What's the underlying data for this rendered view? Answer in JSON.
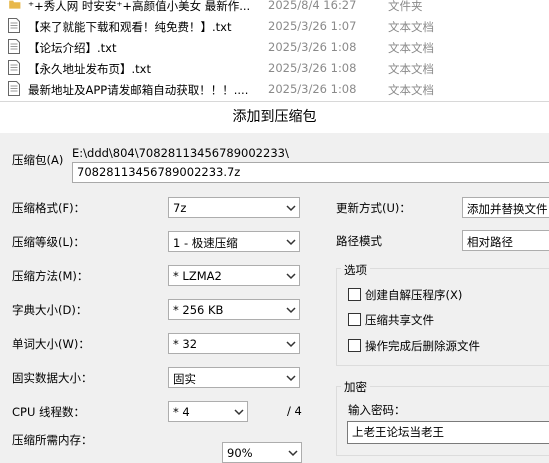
{
  "file_list": [
    {
      "name": "⁺+秀人网 时安安⁺+高颜值小美女 最新作...",
      "date": "2025/8/4 16:27",
      "type": "文件夹",
      "icon": "folder-icon"
    },
    {
      "name": "【来了就能下载和观看！纯免费！】.txt",
      "date": "2025/3/26 1:07",
      "type": "文本文档",
      "icon": "text-file-icon"
    },
    {
      "name": "【论坛介绍】.txt",
      "date": "2025/3/26 1:08",
      "type": "文本文档",
      "icon": "text-file-icon"
    },
    {
      "name": "【永久地址发布页】.txt",
      "date": "2025/3/26 1:08",
      "type": "文本文档",
      "icon": "text-file-icon"
    },
    {
      "name": "最新地址及APP请发邮箱自动获取！！！....",
      "date": "2025/3/26 1:08",
      "type": "文本文档",
      "icon": "text-file-icon"
    }
  ],
  "dialog": {
    "title": "添加到压缩包",
    "archive_label": "压缩包(A)",
    "archive_path": "E:\\ddd\\804\\70828113456789002233\\",
    "archive_name": "70828113456789002233.7z",
    "format_label": "压缩格式(F)：",
    "format_value": "7z",
    "level_label": "压缩等级(L)：",
    "level_value": "1 - 极速压缩",
    "method_label": "压缩方法(M)：",
    "method_value": "* LZMA2",
    "dict_label": "字典大小(D)：",
    "dict_value": "* 256 KB",
    "word_label": "单词大小(W)：",
    "word_value": "* 32",
    "solid_label": "固实数据大小：",
    "solid_value": "固实",
    "threads_label": "CPU 线程数：",
    "threads_value": "* 4",
    "threads_total": "/ 4",
    "memory_label": "压缩所需内存：",
    "memory_value": "90%",
    "update_label": "更新方式(U)：",
    "update_value": "添加并替换文件",
    "path_label": "路径模式",
    "path_value": "相对路径",
    "options_title": "选项",
    "opt_sfx": "创建自解压程序(X)",
    "opt_shared": "压缩共享文件",
    "opt_delete": "操作完成后删除源文件",
    "encrypt_title": "加密",
    "password_label": "输入密码：",
    "password_value": "上老王论坛当老王"
  }
}
